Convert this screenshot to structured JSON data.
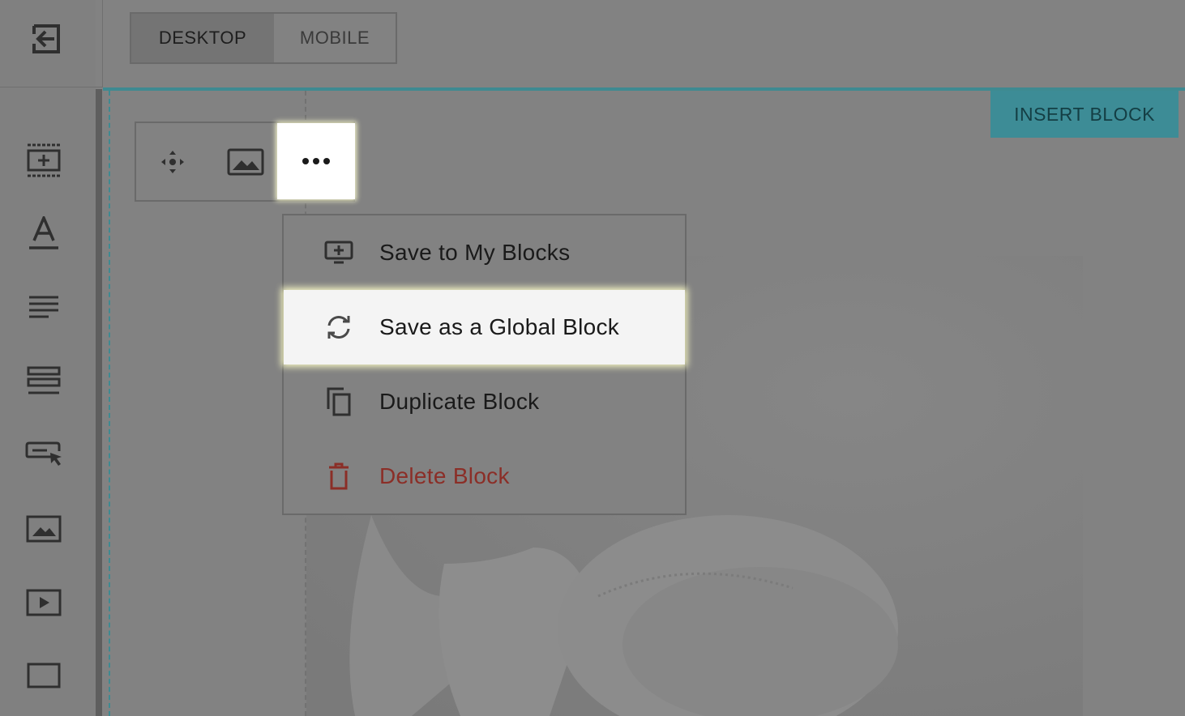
{
  "header": {
    "view_toggle": {
      "desktop_label": "DESKTOP",
      "mobile_label": "MOBILE",
      "selected": "DESKTOP"
    }
  },
  "sidebar": {
    "exit_icon": "exit-icon",
    "tools": [
      {
        "icon": "add-section-icon"
      },
      {
        "icon": "heading-icon"
      },
      {
        "icon": "paragraph-icon"
      },
      {
        "icon": "layout-rows-icon"
      },
      {
        "icon": "button-icon"
      },
      {
        "icon": "image-icon"
      },
      {
        "icon": "video-icon"
      },
      {
        "icon": "container-icon"
      }
    ]
  },
  "canvas": {
    "insert_block_label": "INSERT BLOCK",
    "accent_color": "#3d8c96"
  },
  "block_toolbar": {
    "buttons": [
      {
        "icon": "move-icon"
      },
      {
        "icon": "image-icon"
      },
      {
        "icon": "more-options-icon"
      }
    ]
  },
  "menu": {
    "items": [
      {
        "label": "Save to My Blocks",
        "icon": "save-to-blocks-icon"
      },
      {
        "label": "Save as a Global Block",
        "icon": "sync-icon"
      },
      {
        "label": "Duplicate Block",
        "icon": "duplicate-icon"
      },
      {
        "label": "Delete Block",
        "icon": "trash-icon",
        "color": "#8b2e27"
      }
    ]
  }
}
